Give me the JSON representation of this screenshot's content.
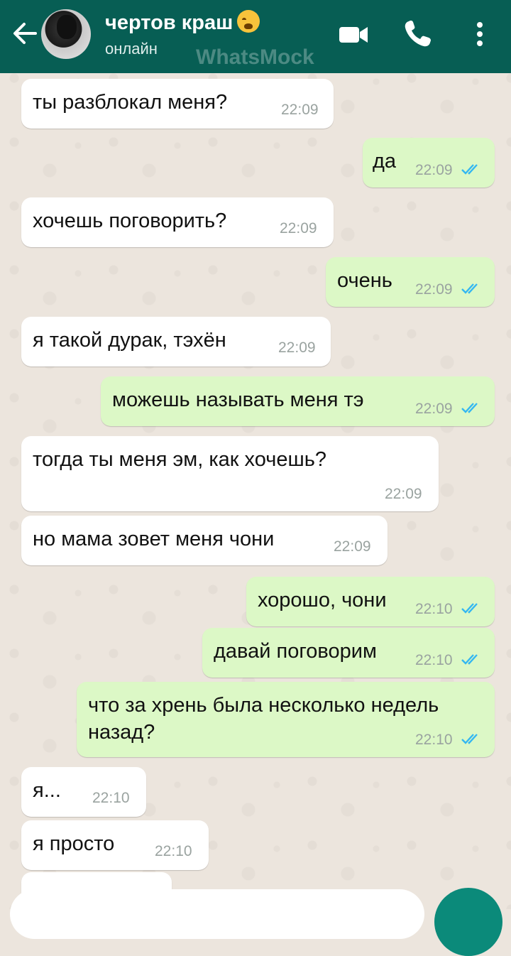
{
  "header": {
    "contact_name": "чертов краш",
    "status": "онлайн",
    "watermark": "WhatsMock",
    "emoji": "loudly-crying-face"
  },
  "colors": {
    "header_bg": "#075e54",
    "incoming_bubble": "#ffffff",
    "outgoing_bubble": "#dcf8c6",
    "read_ticks": "#34b7f1",
    "chat_bg": "#ece5dd"
  },
  "messages": [
    {
      "dir": "in",
      "text": "ты разблокал меня?",
      "time": "22:09"
    },
    {
      "dir": "out",
      "text": "да",
      "time": "22:09",
      "read": true
    },
    {
      "dir": "in",
      "text": "хочешь поговорить?",
      "time": "22:09"
    },
    {
      "dir": "out",
      "text": "очень",
      "time": "22:09",
      "read": true
    },
    {
      "dir": "in",
      "text": "я такой дурак, тэхён",
      "time": "22:09"
    },
    {
      "dir": "out",
      "text": "можешь называть меня тэ",
      "time": "22:09",
      "read": true
    },
    {
      "dir": "in",
      "text": "тогда ты меня эм, как хочешь?",
      "time": "22:09"
    },
    {
      "dir": "in",
      "text": "но мама зовет меня чони",
      "time": "22:09"
    },
    {
      "dir": "out",
      "text": "хорошо, чони",
      "time": "22:10",
      "read": true
    },
    {
      "dir": "out",
      "text": "давай поговорим",
      "time": "22:10",
      "read": true
    },
    {
      "dir": "out",
      "text_line1": "что за хрень была несколько недель",
      "text_line2": "назад?",
      "time": "22:10",
      "read": true
    },
    {
      "dir": "in",
      "text": "я...",
      "time": "22:10"
    },
    {
      "dir": "in",
      "text": "я просто",
      "time": "22:10"
    }
  ]
}
